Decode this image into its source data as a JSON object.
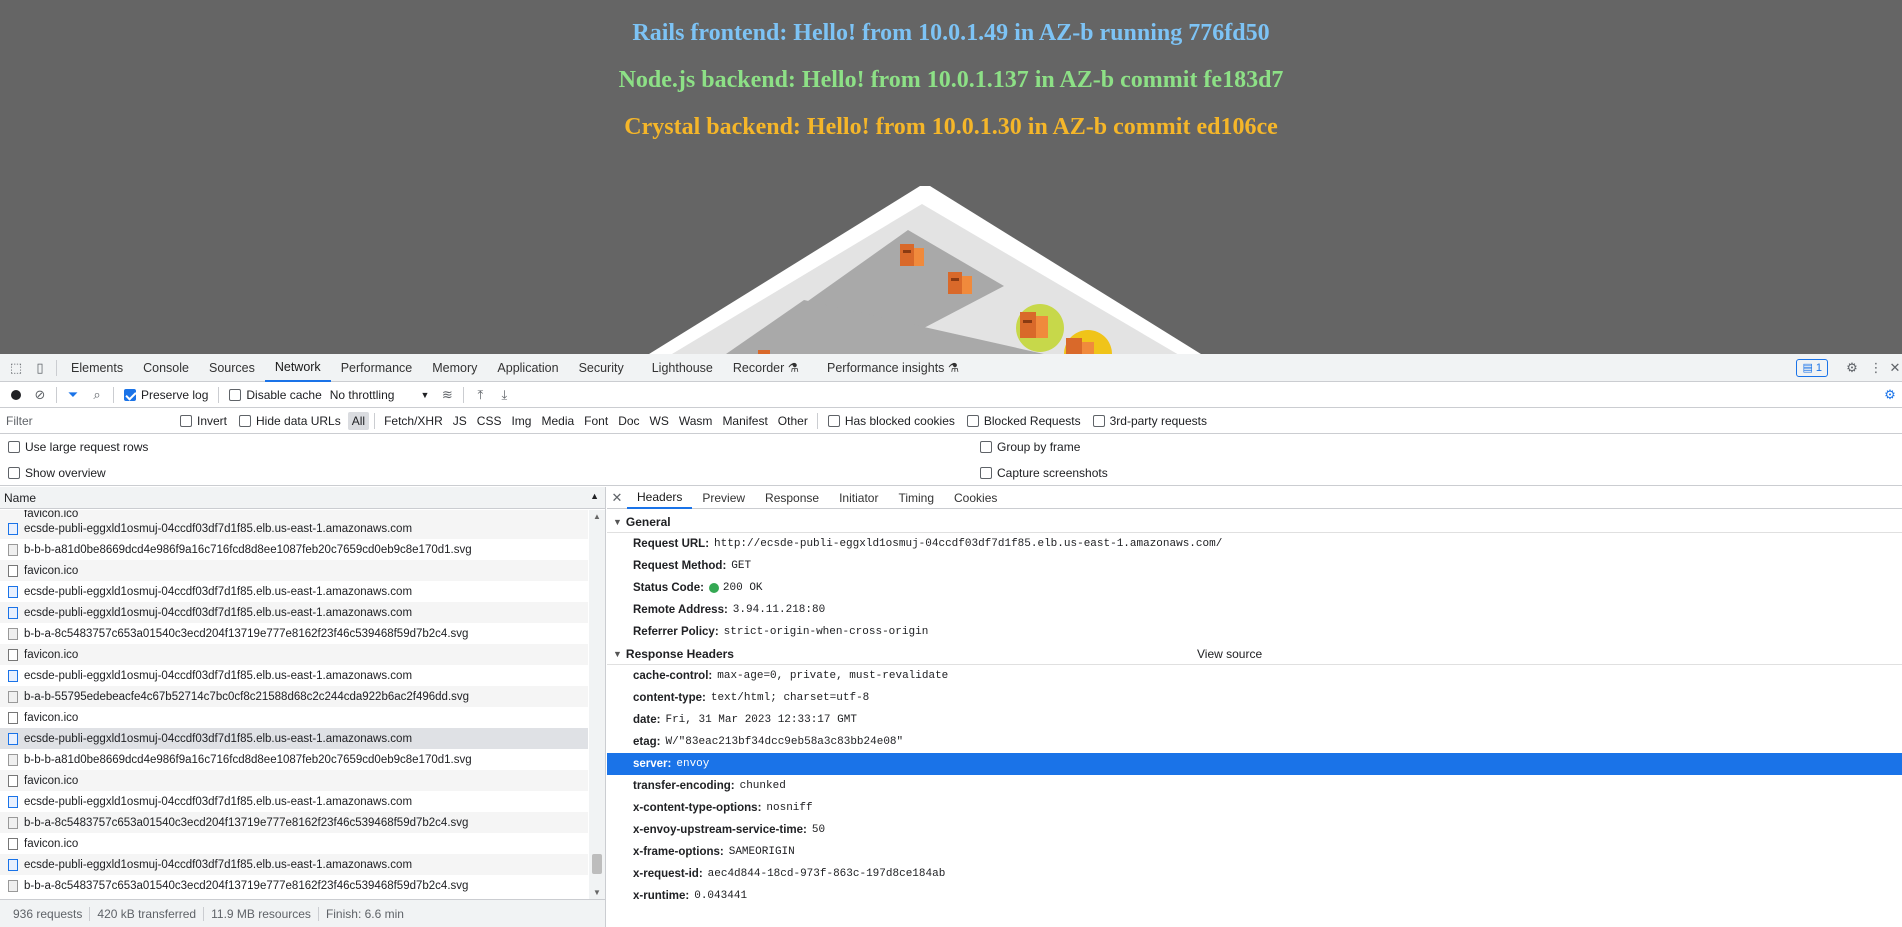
{
  "page": {
    "hello": [
      {
        "text": "Rails frontend: Hello! from 10.0.1.49 in AZ-b running 776fd50",
        "color": "#7dc3f5"
      },
      {
        "text": "Node.js backend: Hello! from 10.0.1.137 in AZ-b commit fe183d7",
        "color": "#8de086"
      },
      {
        "text": "Crystal backend: Hello! from 10.0.1.30 in AZ-b commit ed106ce",
        "color": "#f5b629"
      }
    ]
  },
  "devtools": {
    "tabs": [
      "Elements",
      "Console",
      "Sources",
      "Network",
      "Performance",
      "Memory",
      "Application",
      "Security",
      "Lighthouse",
      "Recorder",
      "Performance insights"
    ],
    "active_tab": "Network",
    "issues_count": "1",
    "toolbar": {
      "preserve_log": "Preserve log",
      "disable_cache": "Disable cache",
      "throttling": "No throttling"
    },
    "filter": {
      "placeholder": "Filter",
      "invert": "Invert",
      "hide_data_urls": "Hide data URLs",
      "types": [
        "All",
        "Fetch/XHR",
        "JS",
        "CSS",
        "Img",
        "Media",
        "Font",
        "Doc",
        "WS",
        "Wasm",
        "Manifest",
        "Other"
      ],
      "has_blocked_cookies": "Has blocked cookies",
      "blocked_requests": "Blocked Requests",
      "third_party": "3rd-party requests"
    },
    "options": {
      "large_rows": "Use large request rows",
      "show_overview": "Show overview",
      "group_by_frame": "Group by frame",
      "capture_screenshots": "Capture screenshots"
    },
    "list": {
      "column": "Name",
      "partial_row": "favicon.ico",
      "rows": [
        {
          "name": "ecsde-publi-eggxld1osmuj-04ccdf03df7d1f85.elb.us-east-1.amazonaws.com",
          "kind": "doc"
        },
        {
          "name": "b-b-b-a81d0be8669dcd4e986f9a16c716fcd8d8ee1087feb20c7659cd0eb9c8e170d1.svg",
          "kind": "svg"
        },
        {
          "name": "favicon.ico",
          "kind": "other"
        },
        {
          "name": "ecsde-publi-eggxld1osmuj-04ccdf03df7d1f85.elb.us-east-1.amazonaws.com",
          "kind": "doc"
        },
        {
          "name": "ecsde-publi-eggxld1osmuj-04ccdf03df7d1f85.elb.us-east-1.amazonaws.com",
          "kind": "doc"
        },
        {
          "name": "b-b-a-8c5483757c653a01540c3ecd204f13719e777e8162f23f46c539468f59d7b2c4.svg",
          "kind": "svg"
        },
        {
          "name": "favicon.ico",
          "kind": "other"
        },
        {
          "name": "ecsde-publi-eggxld1osmuj-04ccdf03df7d1f85.elb.us-east-1.amazonaws.com",
          "kind": "doc"
        },
        {
          "name": "b-a-b-55795edebeacfe4c67b52714c7bc0cf8c21588d68c2c244cda922b6ac2f496dd.svg",
          "kind": "svg"
        },
        {
          "name": "favicon.ico",
          "kind": "other"
        },
        {
          "name": "ecsde-publi-eggxld1osmuj-04ccdf03df7d1f85.elb.us-east-1.amazonaws.com",
          "kind": "doc",
          "selected": true
        },
        {
          "name": "b-b-b-a81d0be8669dcd4e986f9a16c716fcd8d8ee1087feb20c7659cd0eb9c8e170d1.svg",
          "kind": "svg"
        },
        {
          "name": "favicon.ico",
          "kind": "other"
        },
        {
          "name": "ecsde-publi-eggxld1osmuj-04ccdf03df7d1f85.elb.us-east-1.amazonaws.com",
          "kind": "doc"
        },
        {
          "name": "b-b-a-8c5483757c653a01540c3ecd204f13719e777e8162f23f46c539468f59d7b2c4.svg",
          "kind": "svg"
        },
        {
          "name": "favicon.ico",
          "kind": "other"
        },
        {
          "name": "ecsde-publi-eggxld1osmuj-04ccdf03df7d1f85.elb.us-east-1.amazonaws.com",
          "kind": "doc"
        },
        {
          "name": "b-b-a-8c5483757c653a01540c3ecd204f13719e777e8162f23f46c539468f59d7b2c4.svg",
          "kind": "svg"
        }
      ]
    },
    "status": {
      "requests": "936 requests",
      "transferred": "420 kB transferred",
      "resources": "11.9 MB resources",
      "finish": "Finish: 6.6 min"
    },
    "details": {
      "tabs": [
        "Headers",
        "Preview",
        "Response",
        "Initiator",
        "Timing",
        "Cookies"
      ],
      "active_tab": "Headers",
      "general_title": "General",
      "general": [
        {
          "k": "Request URL:",
          "v": "http://ecsde-publi-eggxld1osmuj-04ccdf03df7d1f85.elb.us-east-1.amazonaws.com/"
        },
        {
          "k": "Request Method:",
          "v": "GET"
        },
        {
          "k": "Status Code:",
          "v": "200 OK",
          "status_dot": true
        },
        {
          "k": "Remote Address:",
          "v": "3.94.11.218:80"
        },
        {
          "k": "Referrer Policy:",
          "v": "strict-origin-when-cross-origin"
        }
      ],
      "response_title": "Response Headers",
      "view_source": "View source",
      "response": [
        {
          "k": "cache-control:",
          "v": "max-age=0, private, must-revalidate"
        },
        {
          "k": "content-type:",
          "v": "text/html; charset=utf-8"
        },
        {
          "k": "date:",
          "v": "Fri, 31 Mar 2023 12:33:17 GMT"
        },
        {
          "k": "etag:",
          "v": "W/\"83eac213bf34dcc9eb58a3c83bb24e08\""
        },
        {
          "k": "server:",
          "v": "envoy",
          "highlight": true
        },
        {
          "k": "transfer-encoding:",
          "v": "chunked"
        },
        {
          "k": "x-content-type-options:",
          "v": "nosniff"
        },
        {
          "k": "x-envoy-upstream-service-time:",
          "v": "50"
        },
        {
          "k": "x-frame-options:",
          "v": "SAMEORIGIN"
        },
        {
          "k": "x-request-id:",
          "v": "aec4d844-18cd-973f-863c-197d8ce184ab"
        },
        {
          "k": "x-runtime:",
          "v": "0.043441"
        }
      ]
    }
  }
}
